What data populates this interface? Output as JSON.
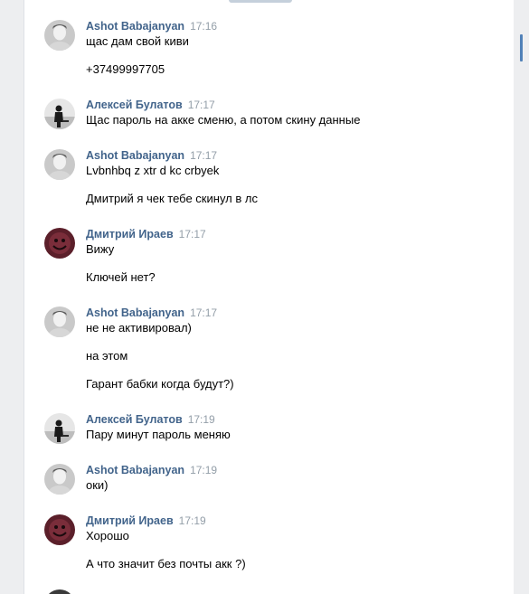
{
  "colors": {
    "page_bg": "#edeef0",
    "panel_bg": "#ffffff",
    "author": "#42648b",
    "time": "#939ea8",
    "text": "#000000",
    "scroll_accent": "#5181b8"
  },
  "messages": [
    {
      "author": "Ashot Babajanyan",
      "time": "17:16",
      "avatar": "ashot-avatar",
      "lines": [
        "щас дам свой киви",
        "+37499997705"
      ]
    },
    {
      "author": "Алексей Булатов",
      "time": "17:17",
      "avatar": "alexey-avatar",
      "lines": [
        "Щас пароль на акке сменю, а потом скину данные"
      ]
    },
    {
      "author": "Ashot Babajanyan",
      "time": "17:17",
      "avatar": "ashot-avatar",
      "lines": [
        "Lvbnhbq z xtr d kc crbyek",
        "Дмитрий я чек тебе скинул в лс"
      ]
    },
    {
      "author": "Дмитрий Ираев",
      "time": "17:17",
      "avatar": "dmitry-avatar",
      "lines": [
        "Вижу",
        "Ключей нет?"
      ]
    },
    {
      "author": "Ashot Babajanyan",
      "time": "17:17",
      "avatar": "ashot-avatar",
      "lines": [
        "не не активировал)",
        "на этом",
        "Гарант бабки когда будут?)"
      ]
    },
    {
      "author": "Алексей Булатов",
      "time": "17:19",
      "avatar": "alexey-avatar",
      "lines": [
        "Пару минут пароль меняю"
      ]
    },
    {
      "author": "Ashot Babajanyan",
      "time": "17:19",
      "avatar": "ashot-avatar",
      "lines": [
        "оки)"
      ]
    },
    {
      "author": "Дмитрий Ираев",
      "time": "17:19",
      "avatar": "dmitry-avatar",
      "lines": [
        "Хорошо",
        "А что значит без почты акк ?)"
      ]
    }
  ]
}
